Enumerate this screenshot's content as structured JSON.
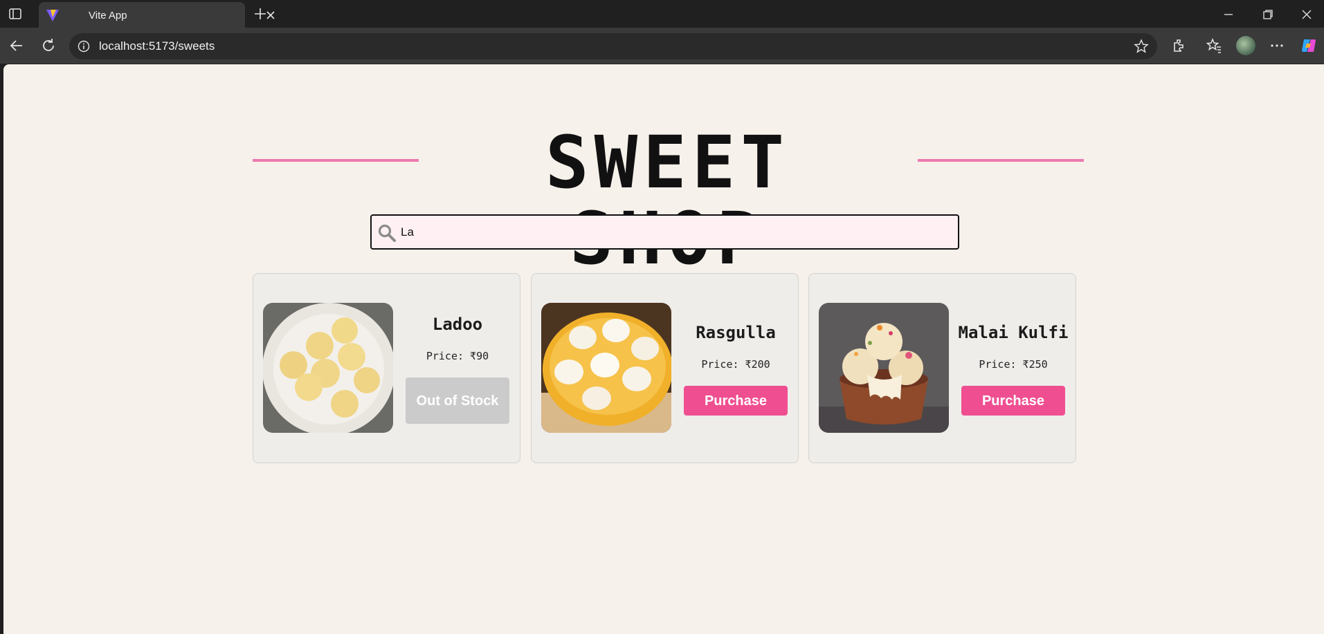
{
  "browser": {
    "tab_title": "Vite App",
    "url": "localhost:5173/sweets"
  },
  "header": {
    "title": "SWEET SHOP"
  },
  "search": {
    "value": "La"
  },
  "sweets": [
    {
      "name": "Ladoo",
      "price": "Price: ₹90",
      "button": "Out of Stock",
      "in_stock": false
    },
    {
      "name": "Rasgulla",
      "price": "Price: ₹200",
      "button": "Purchase",
      "in_stock": true
    },
    {
      "name": "Malai Kulfi",
      "price": "Price: ₹250",
      "button": "Purchase",
      "in_stock": true
    }
  ],
  "colors": {
    "accent": "#ef4f91",
    "accent_line": "#ec7ab0",
    "page_bg": "#f6f1ea",
    "search_bg": "#fff0f3",
    "disabled": "#cbcbcb"
  }
}
